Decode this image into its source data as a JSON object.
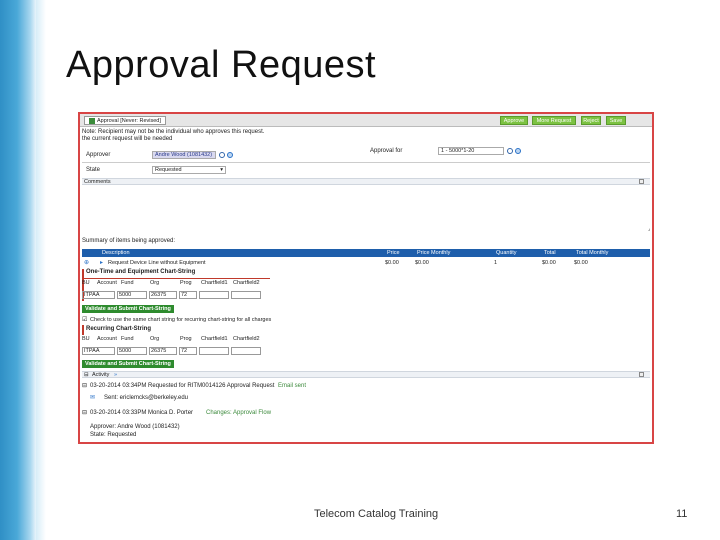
{
  "slide": {
    "title": "Approval Request",
    "footer": "Telecom Catalog Training",
    "page_number": "11"
  },
  "toolbar": {
    "tab_title": "Approval [Never: Revised]",
    "approve_label": "Approve",
    "more_info_label": "More Request",
    "reject_label": "Reject",
    "save_label": "Save"
  },
  "form": {
    "intro_line1": "Note: Recipient may not be the individual who approves this request.",
    "intro_line2": "the current request will be needed",
    "approver_label": "Approver",
    "approver_value": "Andre Wood (1081432)",
    "approval_for_label": "Approval for",
    "approval_for_value": "1 - 5000*1-20",
    "state_label": "State",
    "state_value": "Requested",
    "comments_label": "Comments"
  },
  "summary": {
    "heading": "Summary of items being approved:",
    "columns": [
      "Description",
      "Price",
      "Price Monthly",
      "Quantity",
      "Total",
      "Total Monthly"
    ],
    "row": {
      "description": "Request Device Line without Equipment",
      "price": "$0.00",
      "price_monthly": "$0.00",
      "quantity": "1",
      "total": "$0.00",
      "total_monthly": "$0.00"
    }
  },
  "onetime": {
    "heading": "One-Time and Equipment Chart-String",
    "headers": [
      "BU",
      "Account",
      "Fund",
      "Org",
      "Prog",
      "Chartfield1",
      "Chartfield2"
    ],
    "values": [
      "ITPAA",
      "",
      "5000",
      "26375",
      "72",
      "",
      ""
    ],
    "button": "Validate and Submit Chart-String"
  },
  "checkbox_line": "Check to use the same chart string for recurring chart-string for all charges",
  "recurring": {
    "heading": "Recurring Chart-String",
    "headers": [
      "BU",
      "Account",
      "Fund",
      "Org",
      "Prog",
      "Chartfield1",
      "Chartfield2"
    ],
    "values": [
      "ITPAA",
      "",
      "5000",
      "26375",
      "72",
      "",
      ""
    ],
    "button": "Validate and Submit Chart-String"
  },
  "activity": {
    "label": "Activity",
    "entry1": "03-20-2014 03:34PM Requested for RITM0014126 Approval Request",
    "entry1_link": "Email sent",
    "entry1_email": "Sent: ericlemcks@berkeley.edu",
    "entry2": "03-20-2014 03:33PM Monica D. Porter",
    "entry2_link": "Changes: Approval Flow",
    "entry2_line1": "Approver: Andre Wood (1081432)",
    "entry2_line2": "State: Requested"
  },
  "colors": {
    "accent_band": "#4aa8d8",
    "border": "#d84545",
    "toolbar_button": "#7cc242",
    "table_header": "#1e5eab"
  }
}
